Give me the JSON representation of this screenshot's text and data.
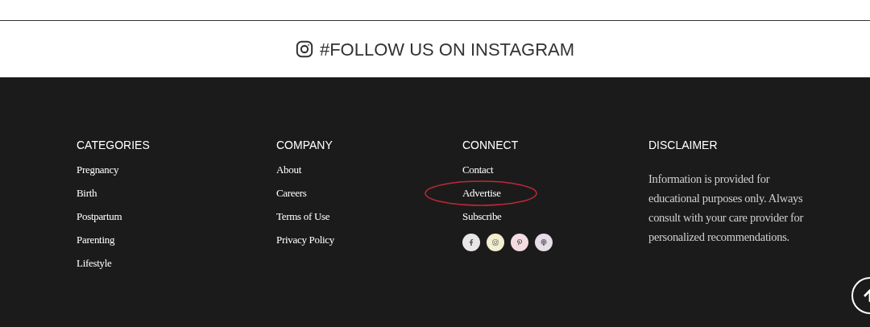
{
  "instagram_banner": {
    "text": "#FOLLOW US ON INSTAGRAM"
  },
  "footer": {
    "columns": [
      {
        "heading": "CATEGORIES",
        "links": [
          {
            "label": "Pregnancy",
            "circled": false
          },
          {
            "label": "Birth",
            "circled": false
          },
          {
            "label": "Postpartum",
            "circled": false
          },
          {
            "label": "Parenting",
            "circled": false
          },
          {
            "label": "Lifestyle",
            "circled": false
          }
        ]
      },
      {
        "heading": "COMPANY",
        "links": [
          {
            "label": "About",
            "circled": false
          },
          {
            "label": "Careers",
            "circled": false
          },
          {
            "label": "Terms of Use",
            "circled": false
          },
          {
            "label": "Privacy Policy",
            "circled": false
          }
        ]
      },
      {
        "heading": "CONNECT",
        "links": [
          {
            "label": "Contact",
            "circled": false
          },
          {
            "label": "Advertise",
            "circled": true
          },
          {
            "label": "Subscribe",
            "circled": false
          }
        ],
        "social": [
          {
            "kind": "facebook",
            "color": "#e8e6e6"
          },
          {
            "kind": "instagram",
            "color": "#f2efcf"
          },
          {
            "kind": "pinterest",
            "color": "#f4dde2"
          },
          {
            "kind": "podcast",
            "color": "#e6dde8"
          }
        ]
      },
      {
        "heading": "DISCLAIMER",
        "text": "Information is provided for educational purposes only. Always consult with your care provider for personalized recommendations."
      }
    ]
  }
}
